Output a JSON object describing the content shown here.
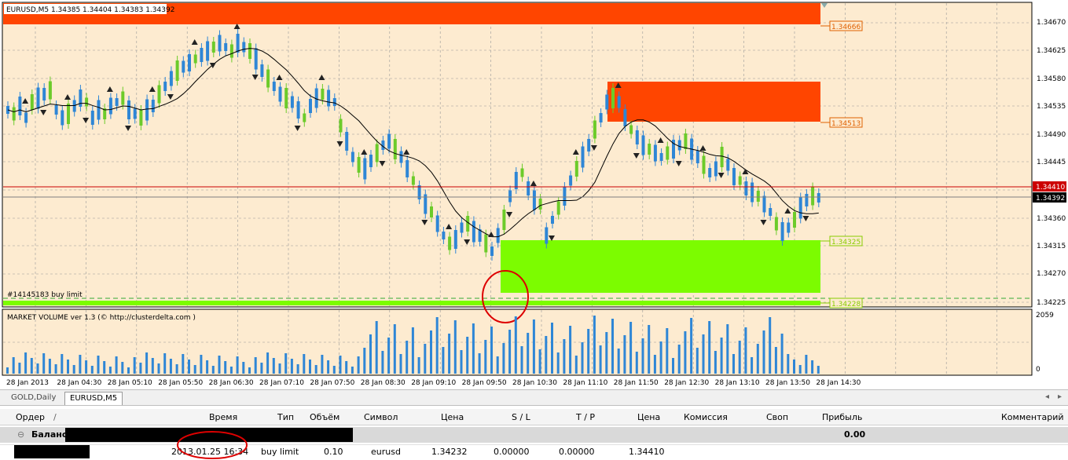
{
  "chart": {
    "header": "EURUSD,M5  1.34385 1.34404 1.34383 1.34392",
    "order_label": "#14145183 buy limit",
    "indicator_title": "MARKET VOLUME ver 1.3 (© http://clusterdelta.com )",
    "volume_axis": [
      "2059",
      "0"
    ],
    "price_axis": [
      "1.34670",
      "1.34625",
      "1.34580",
      "1.34535",
      "1.34490",
      "1.34445",
      "1.34360",
      "1.34315",
      "1.34270",
      "1.34225"
    ],
    "level_labels": [
      {
        "text": "1.34666",
        "color": "#e06000"
      },
      {
        "text": "1.34513",
        "color": "#e06000"
      },
      {
        "text": "1.34325",
        "color": "#88cc00"
      },
      {
        "text": "1.34228",
        "color": "#88cc00"
      }
    ],
    "bid_label": "1.34410",
    "current_label": "1.34392",
    "time_axis": [
      "28 Jan 2013",
      "28 Jan 04:30",
      "28 Jan 05:10",
      "28 Jan 05:50",
      "28 Jan 06:30",
      "28 Jan 07:10",
      "28 Jan 07:50",
      "28 Jan 08:30",
      "28 Jan 09:10",
      "28 Jan 09:50",
      "28 Jan 10:30",
      "28 Jan 11:10",
      "28 Jan 11:50",
      "28 Jan 12:30",
      "28 Jan 13:10",
      "28 Jan 13:50",
      "28 Jan 14:30"
    ],
    "colors": {
      "background": "#fdebd0",
      "grid": "#8c8c8c",
      "up_candle": "#2e86d6",
      "down_candle": "#6ccb2a",
      "resistance_zone": "#ff4500",
      "support_zone": "#7cfc00",
      "bid_line": "#cc0000"
    }
  },
  "tabs": [
    "GOLD,Daily",
    "EURUSD,M5"
  ],
  "terminal": {
    "columns": [
      "Ордер",
      "/",
      "Время",
      "Тип",
      "Объём",
      "Символ",
      "Цена",
      "S / L",
      "T / P",
      "Цена",
      "Комиссия",
      "Своп",
      "Прибыль",
      "Комментарий"
    ],
    "balance_label": "Баланс:",
    "balance_profit": "0.00",
    "order": {
      "time": "2013.01.25 16:34",
      "type": "buy limit",
      "volume": "0.10",
      "symbol": "eurusd",
      "price": "1.34232",
      "sl": "0.00000",
      "tp": "0.00000",
      "current_price": "1.34410"
    }
  }
}
